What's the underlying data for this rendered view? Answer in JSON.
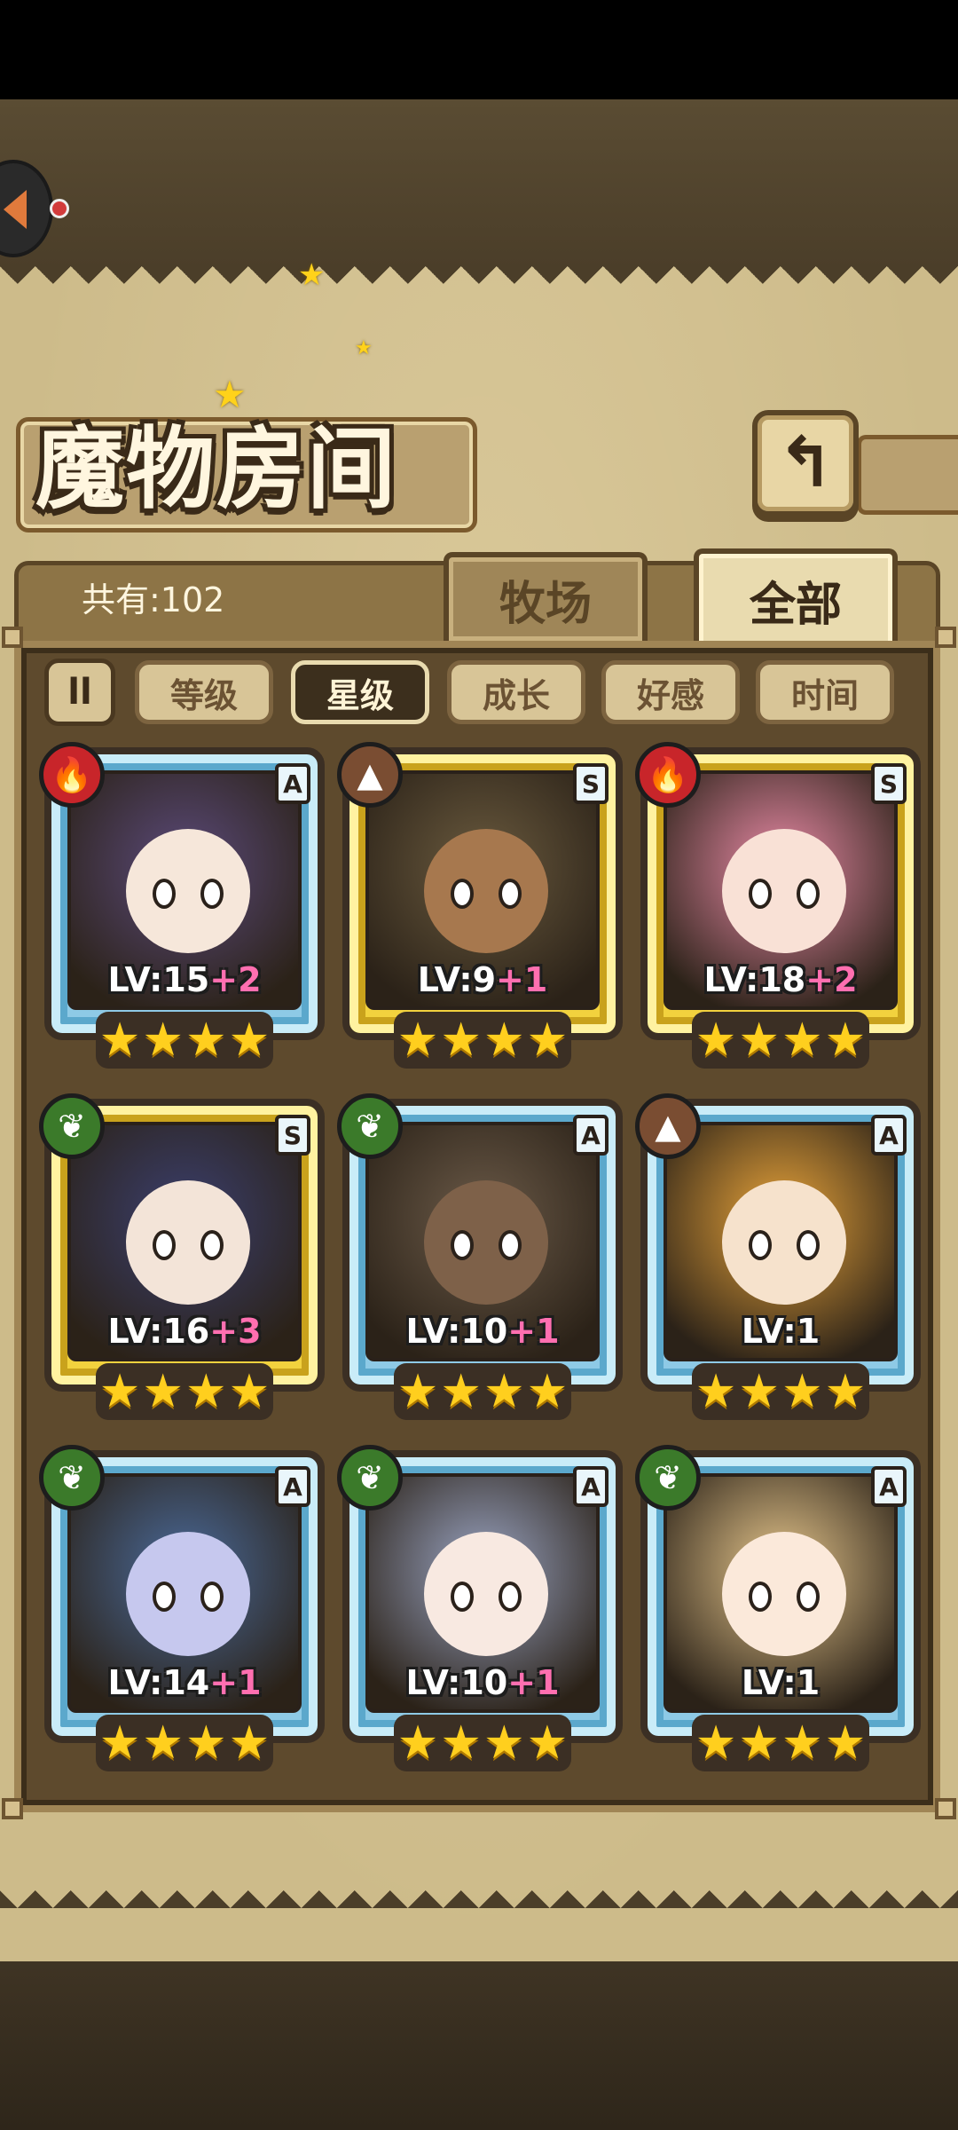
{
  "header": {
    "title": "魔物房间",
    "back_icon": "↰",
    "home_icon": "home-icon"
  },
  "stats": {
    "count_text": "共有:102"
  },
  "tabs": [
    {
      "label": "牧场",
      "active": false
    },
    {
      "label": "全部",
      "active": true
    }
  ],
  "sort": {
    "toggle_icon": "ll",
    "options": [
      {
        "label": "等级",
        "active": false
      },
      {
        "label": "星级",
        "active": true
      },
      {
        "label": "成长",
        "active": false
      },
      {
        "label": "好感",
        "active": false
      },
      {
        "label": "时间",
        "active": false
      }
    ]
  },
  "monsters": [
    {
      "element": "fire",
      "rank": "A",
      "level": "LV:15",
      "bonus": "+2",
      "stars": 4
    },
    {
      "element": "earth",
      "rank": "S",
      "level": "LV:9",
      "bonus": "+1",
      "stars": 4
    },
    {
      "element": "fire",
      "rank": "S",
      "level": "LV:18",
      "bonus": "+2",
      "stars": 4
    },
    {
      "element": "leaf",
      "rank": "S",
      "level": "LV:16",
      "bonus": "+3",
      "stars": 4
    },
    {
      "element": "leaf",
      "rank": "A",
      "level": "LV:10",
      "bonus": "+1",
      "stars": 4
    },
    {
      "element": "earth",
      "rank": "A",
      "level": "LV:1",
      "bonus": "",
      "stars": 4
    },
    {
      "element": "leaf",
      "rank": "A",
      "level": "LV:14",
      "bonus": "+1",
      "stars": 4
    },
    {
      "element": "leaf",
      "rank": "A",
      "level": "LV:10",
      "bonus": "+1",
      "stars": 4
    },
    {
      "element": "leaf",
      "rank": "A",
      "level": "LV:1",
      "bonus": "",
      "stars": 4
    }
  ],
  "element_icons": {
    "fire": "🔥",
    "earth": "▲",
    "leaf": "❦"
  },
  "colors": {
    "rank_a_frame": "#8ecae6",
    "rank_s_frame": "#f2d23e",
    "level_bonus": "#ff6fb0",
    "star": "#ffcf1e"
  }
}
